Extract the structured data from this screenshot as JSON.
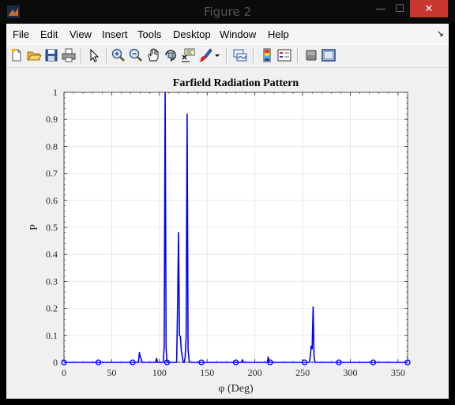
{
  "window": {
    "title": "Figure 2",
    "close_symbol": "✕",
    "minimize_symbol": "—",
    "maximize_symbol": "☐"
  },
  "menu": {
    "items": [
      "File",
      "Edit",
      "View",
      "Insert",
      "Tools",
      "Desktop",
      "Window",
      "Help"
    ],
    "dock_symbol": "↘"
  },
  "toolbar": {
    "icons": [
      "new-figure-icon",
      "open-file-icon",
      "save-icon",
      "print-icon",
      "edit-plot-icon",
      "zoom-in-icon",
      "zoom-out-icon",
      "pan-icon",
      "rotate-3d-icon",
      "data-cursor-icon",
      "brush-icon",
      "brush-dropdown-icon",
      "link-plot-icon",
      "insert-colorbar-icon",
      "insert-legend-icon",
      "hide-plot-tools-icon",
      "show-plot-tools-icon"
    ]
  },
  "colors": {
    "series": "#0000ff",
    "close_button": "#c7372f"
  },
  "chart_data": {
    "type": "line",
    "title": "Farfield Radiation Pattern",
    "xlabel": "φ (Deg)",
    "ylabel": "P",
    "xlim": [
      0,
      360
    ],
    "ylim": [
      0,
      1
    ],
    "xticks": [
      "0",
      "50",
      "100",
      "150",
      "200",
      "250",
      "300",
      "350"
    ],
    "yticks": [
      "0",
      "0.1",
      "0.2",
      "0.3",
      "0.4",
      "0.5",
      "0.6",
      "0.7",
      "0.8",
      "0.9",
      "1"
    ],
    "grid": true,
    "series": [
      {
        "color": "#0000ff",
        "x": [
          0,
          78,
          79,
          80,
          81,
          82,
          96,
          97,
          98,
          104,
          105,
          106,
          107,
          108,
          118,
          119,
          120,
          121,
          122,
          123,
          124,
          125,
          126,
          127,
          128,
          129,
          130,
          131,
          132,
          186,
          187,
          188,
          213,
          214,
          215,
          257,
          258,
          259,
          260,
          261,
          262,
          263,
          360
        ],
        "y": [
          0,
          0,
          0.036,
          0.02,
          0.012,
          0,
          0,
          0.015,
          0,
          0,
          0.06,
          1.0,
          0.05,
          0,
          0,
          0.2,
          0.48,
          0.1,
          0.095,
          0.04,
          0.02,
          0,
          0,
          0.02,
          0.1,
          0.92,
          0.05,
          0.01,
          0,
          0,
          0.01,
          0,
          0,
          0.02,
          0,
          0,
          0.02,
          0.06,
          0.05,
          0.205,
          0.02,
          0,
          0
        ]
      }
    ],
    "markers": {
      "shape": "circle",
      "x": [
        0,
        36,
        72,
        108,
        144,
        180,
        216,
        252,
        288,
        324,
        360
      ],
      "y": [
        0,
        0,
        0,
        0,
        0,
        0,
        0,
        0,
        0,
        0,
        0
      ]
    }
  }
}
